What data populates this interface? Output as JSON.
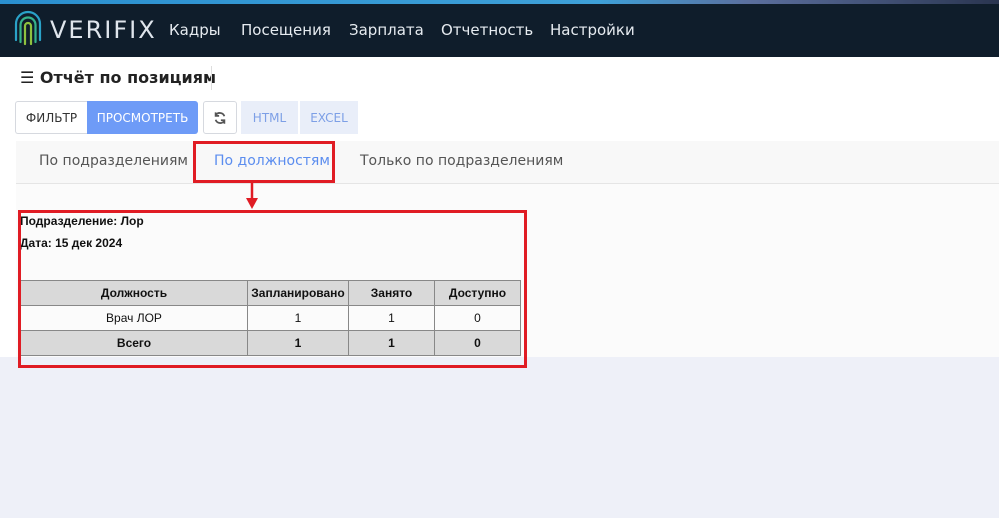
{
  "app": {
    "logo_text": "VERIFIX"
  },
  "nav": {
    "items": [
      "Кадры",
      "Посещения",
      "Зарплата",
      "Отчетность",
      "Настройки"
    ]
  },
  "page": {
    "title": "Отчёт по позициям"
  },
  "toolbar": {
    "filter_label": "ФИЛЬТР",
    "view_label": "ПРОСМОТРЕТЬ",
    "html_label": "HTML",
    "excel_label": "EXCEL"
  },
  "tabs": [
    {
      "label": "По подразделениям",
      "active": false
    },
    {
      "label": "По должностям",
      "active": true
    },
    {
      "label": "Только по подразделениям",
      "active": false
    }
  ],
  "report": {
    "division": "Подразделение: Лор",
    "date": "Дата: 15 дек 2024",
    "headers": [
      "Должность",
      "Запланировано",
      "Занято",
      "Доступно"
    ],
    "rows": [
      [
        "Врач ЛОР",
        "1",
        "1",
        "0"
      ]
    ],
    "total": [
      "Всего",
      "1",
      "1",
      "0"
    ]
  },
  "colors": {
    "highlight": "#e01c24",
    "accent": "#6e9bf7",
    "topbar": "#0f1d2b"
  }
}
